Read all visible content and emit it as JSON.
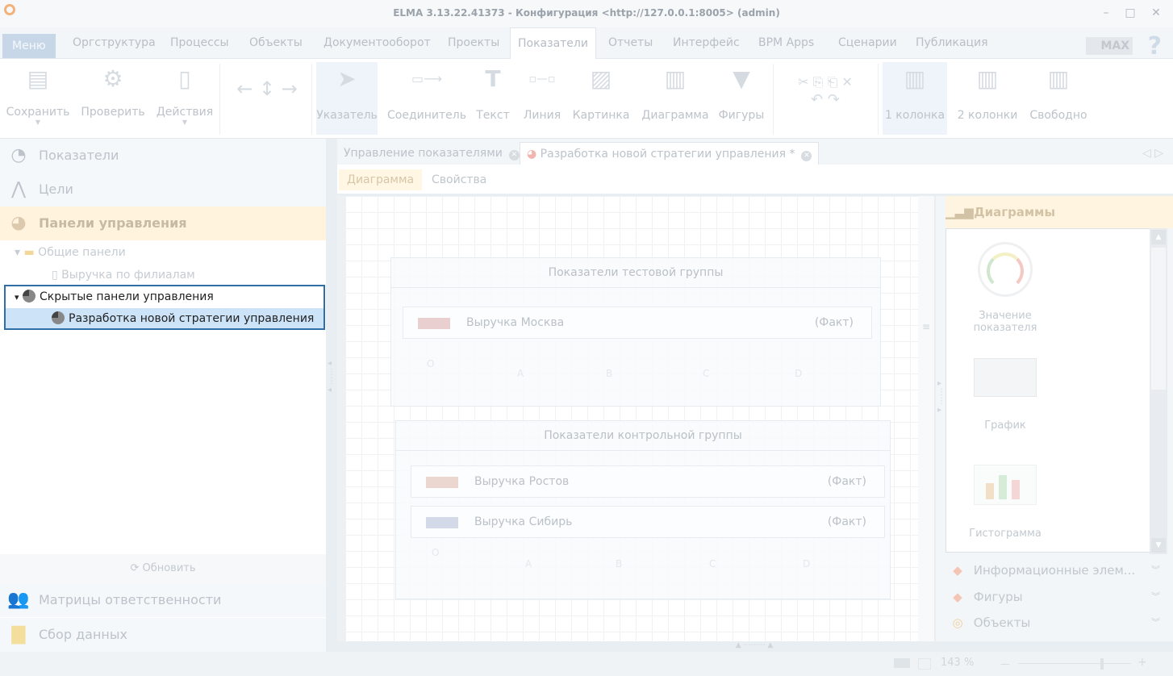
{
  "window": {
    "title": "ELMA 3.13.22.41373 - Конфигурация <http://127.0.0.1:8005> (admin)"
  },
  "menu": {
    "tabs": [
      "Меню",
      "Оргструктура",
      "Процессы",
      "Объекты",
      "Документооборот",
      "Проекты",
      "Показатели",
      "Отчеты",
      "Интерфейс",
      "BPM Apps",
      "Сценарии",
      "Публикация"
    ],
    "active": "Показатели",
    "brand": "MAX",
    "help": "?"
  },
  "ribbon": {
    "save": "Сохранить",
    "check": "Проверить",
    "actions": "Действия",
    "pointer": "Указатель",
    "connector": "Соединитель",
    "text": "Текст",
    "line": "Линия",
    "picture": "Картинка",
    "diagram": "Диаграмма",
    "shapes": "Фигуры",
    "one_col": "1 колонка",
    "two_col": "2 колонки",
    "free": "Свободно"
  },
  "nav": {
    "indicators": "Показатели",
    "goals": "Цели",
    "dashboards": "Панели управления",
    "responsibility": "Матрицы ответственности",
    "data_collection": "Сбор данных",
    "refresh": "Обновить"
  },
  "tree": {
    "common": "Общие панели",
    "revenue_branches": "Выручка по филиалам",
    "hidden": "Скрытые панели управления",
    "new_strategy": "Разработка новой стратегии управления"
  },
  "doc_tabs": {
    "tab1": "Управление показателями",
    "tab2": "Разработка новой стратегии управления *"
  },
  "sub_tabs": {
    "diagram": "Диаграмма",
    "properties": "Свойства"
  },
  "canvas": {
    "group1": {
      "title": "Показатели тестовой группы",
      "rows": [
        {
          "name": "Выручка Москва",
          "kind": "(Факт)",
          "color": "#e9cfcf"
        }
      ]
    },
    "group2": {
      "title": "Показатели контрольной группы",
      "rows": [
        {
          "name": "Выручка Ростов",
          "kind": "(Факт)",
          "color": "#ecd6d0"
        },
        {
          "name": "Выручка Сибирь",
          "kind": "(Факт)",
          "color": "#d4d9e8"
        }
      ]
    }
  },
  "toolbox": {
    "title": "Диаграммы",
    "items": [
      "Значение показателя",
      "График",
      "Гистограмма"
    ],
    "sections": [
      "Информационные элем...",
      "Фигуры",
      "Объекты"
    ]
  },
  "status": {
    "zoom": "143 %"
  }
}
